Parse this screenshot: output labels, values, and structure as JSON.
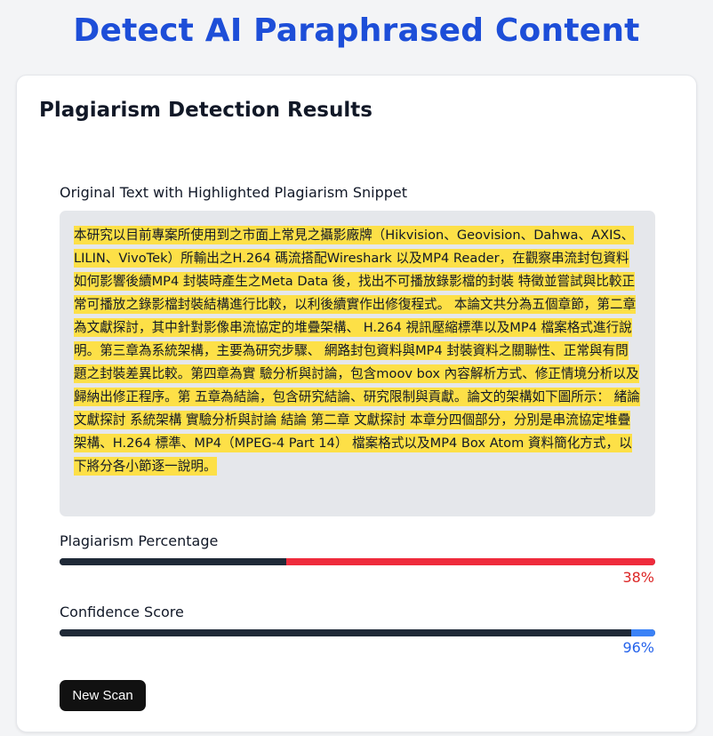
{
  "page": {
    "title": "Detect AI Paraphrased Content"
  },
  "results": {
    "title": "Plagiarism Detection Results",
    "original_text_label": "Original Text with Highlighted Plagiarism Snippet",
    "highlighted_text": "本研究以目前專案所使用到之市面上常見之攝影廠牌（Hikvision、Geovision、Dahwa、AXIS、LILIN、VivoTek）所輸出之H.264 碼流搭配Wireshark 以及MP4 Reader，在觀察串流封包資料如何影響後續MP4 封裝時產生之Meta Data 後，找出不可播放錄影檔的封裝 特徵並嘗試與比較正常可播放之錄影檔封裝結構進行比較，以利後續實作出修復程式。 本論文共分為五個章節，第二章為文獻探討，其中針對影像串流協定的堆疊架構、 H.264 視訊壓縮標準以及MP4 檔案格式進行說明。第三章為系統架構，主要為研究步驟、 網路封包資料與MP4 封裝資料之關聯性、正常與有問題之封裝差異比較。第四章為實 驗分析與討論，包含moov box 內容解析方式、修正情境分析以及歸納出修正程序。第 五章為結論，包含研究結論、研究限制與貢獻。論文的架構如下圖所示： 緒論 文獻探討 系統架構 實驗分析與討論 結論 第二章 文獻探討 本章分四個部分，分別是串流協定堆疊架構、H.264 標準、MP4（MPEG-4 Part 14） 檔案格式以及MP4 Box Atom 資料簡化方式，以下將分各小節逐一說明。",
    "plagiarism": {
      "label": "Plagiarism Percentage",
      "value_text": "38%",
      "fraction": 0.38,
      "color": "#ef2b3c",
      "text_color": "#dc2626"
    },
    "confidence": {
      "label": "Confidence Score",
      "value_text": "96%",
      "fraction": 0.96,
      "color": "#3b82f6",
      "text_color": "#2563eb"
    },
    "new_scan_label": "New Scan"
  }
}
